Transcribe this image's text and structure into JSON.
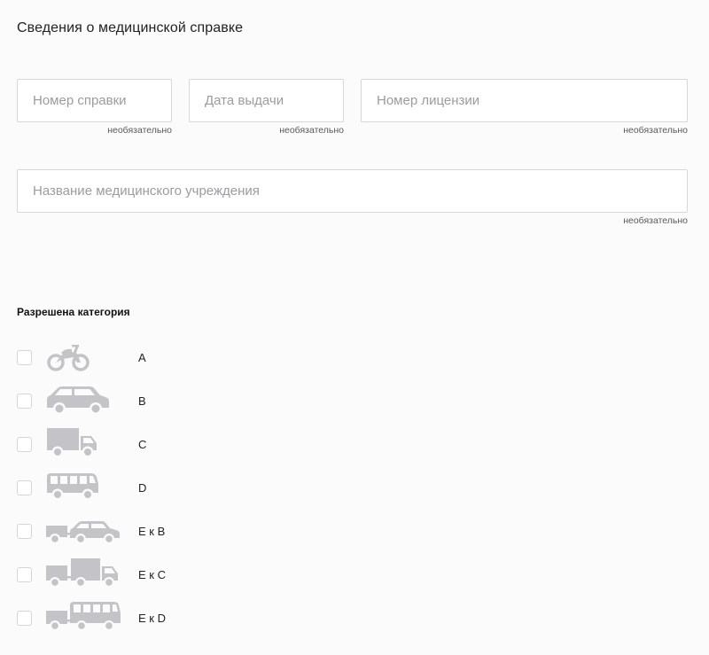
{
  "section_title": "Сведения о медицинской справке",
  "fields": {
    "cert_number": {
      "placeholder": "Номер справки",
      "value": "",
      "hint": "необязательно"
    },
    "issue_date": {
      "placeholder": "Дата выдачи",
      "value": "",
      "hint": "необязательно"
    },
    "license_number": {
      "placeholder": "Номер лицензии",
      "value": "",
      "hint": "необязательно"
    },
    "institution": {
      "placeholder": "Название медицинского учреждения",
      "value": "",
      "hint": "необязательно"
    }
  },
  "categories": {
    "title": "Разрешена категория",
    "items": [
      {
        "label": "A",
        "icon": "motorcycle-icon",
        "checked": false
      },
      {
        "label": "B",
        "icon": "car-icon",
        "checked": false
      },
      {
        "label": "C",
        "icon": "truck-icon",
        "checked": false
      },
      {
        "label": "D",
        "icon": "bus-icon",
        "checked": false
      },
      {
        "label": "E к B",
        "icon": "car-trailer-icon",
        "checked": false
      },
      {
        "label": "E к C",
        "icon": "truck-trailer-icon",
        "checked": false
      },
      {
        "label": "E к D",
        "icon": "bus-trailer-icon",
        "checked": false
      }
    ]
  },
  "colors": {
    "icon": "#c4c4c8",
    "border": "#d6d6dc",
    "placeholder": "#9b9ba1"
  }
}
